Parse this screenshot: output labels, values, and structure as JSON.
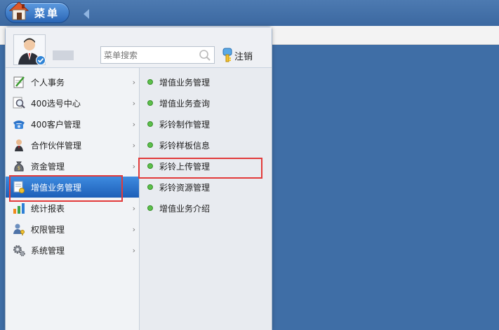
{
  "topbar": {
    "menu_label": "菜单"
  },
  "header": {
    "search_placeholder": "菜单搜索",
    "logout_label": "注销"
  },
  "left_menu": [
    {
      "label": "个人事务",
      "icon": "notepad-icon"
    },
    {
      "label": "400选号中心",
      "icon": "magnifier-icon"
    },
    {
      "label": "400客户管理",
      "icon": "telephone-icon"
    },
    {
      "label": "合作伙伴管理",
      "icon": "person-icon"
    },
    {
      "label": "资金管理",
      "icon": "money-bag-icon"
    },
    {
      "label": "增值业务管理",
      "icon": "certificate-icon",
      "active": true
    },
    {
      "label": "统计报表",
      "icon": "bar-chart-icon"
    },
    {
      "label": "权限管理",
      "icon": "user-key-icon"
    },
    {
      "label": "系统管理",
      "icon": "gears-icon"
    }
  ],
  "right_menu": [
    {
      "label": "增值业务管理"
    },
    {
      "label": "增值业务查询"
    },
    {
      "label": "彩铃制作管理"
    },
    {
      "label": "彩铃样板信息"
    },
    {
      "label": "彩铃上传管理"
    },
    {
      "label": "彩铃资源管理"
    },
    {
      "label": "增值业务介绍"
    }
  ],
  "colors": {
    "background": "#3f6ea6",
    "active_item": "#2f76d0",
    "highlight_box": "#e23a3a",
    "status_dot": "#5cc04a"
  }
}
